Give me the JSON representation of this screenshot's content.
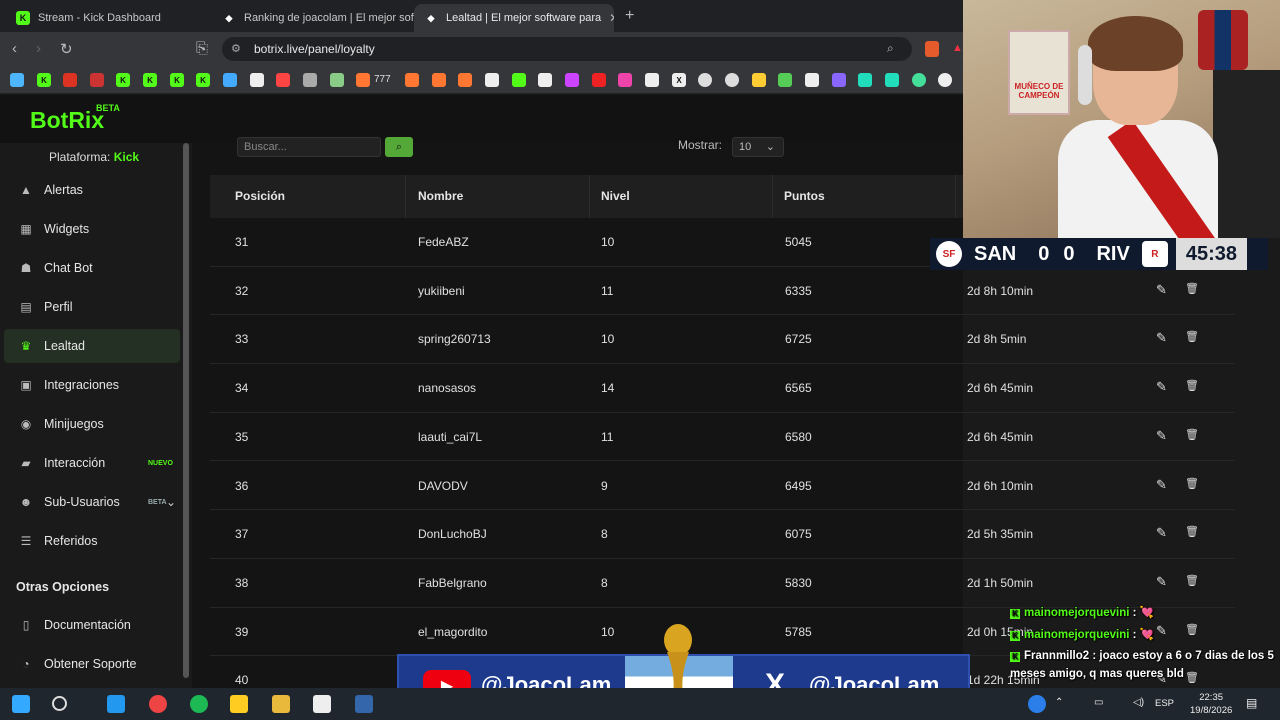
{
  "browser": {
    "tabs": [
      {
        "title": "Stream - Kick Dashboard",
        "fav": "K",
        "fav_color": "#53fc18"
      },
      {
        "title": "Ranking de joacolam | El mejor softw",
        "fav": "◆",
        "fav_color": "#ffffff"
      },
      {
        "title": "Lealtad | El mejor software para",
        "fav": "◆",
        "fav_color": "#ffffff",
        "active": true
      }
    ],
    "close_tab": "✕",
    "new_tab": "+",
    "url": "botrix.live/panel/loyalty",
    "bookmark_badge": "777"
  },
  "app": {
    "logo": "BotRix",
    "logo_badge": "BETA",
    "platform_label": "Plataforma:",
    "platform_value": "Kick"
  },
  "sidebar": {
    "items": [
      {
        "label": "Alertas",
        "icon": "alert-icon",
        "glyph": "▲"
      },
      {
        "label": "Widgets",
        "icon": "widgets-icon",
        "glyph": "▦"
      },
      {
        "label": "Chat Bot",
        "icon": "robot-icon",
        "glyph": "☗"
      },
      {
        "label": "Perfil",
        "icon": "profile-card-icon",
        "glyph": "▤"
      },
      {
        "label": "Lealtad",
        "icon": "trophy-icon",
        "glyph": "♛",
        "active": true
      },
      {
        "label": "Integraciones",
        "icon": "integrations-icon",
        "glyph": "▣"
      },
      {
        "label": "Minijuegos",
        "icon": "gamepad-icon",
        "glyph": "◉"
      },
      {
        "label": "Interacción",
        "icon": "interaction-icon",
        "glyph": "▰",
        "badge": "NUEVO"
      },
      {
        "label": "Sub-Usuarios",
        "icon": "users-icon",
        "glyph": "☻",
        "badge": "BETA",
        "chevron": "⌄"
      },
      {
        "label": "Referidos",
        "icon": "referrals-icon",
        "glyph": "☰"
      }
    ],
    "other_heading": "Otras Opciones",
    "other_items": [
      {
        "label": "Documentación",
        "icon": "document-icon",
        "glyph": "▯"
      },
      {
        "label": "Obtener Soporte",
        "icon": "support-icon",
        "glyph": "◔"
      }
    ]
  },
  "table_controls": {
    "search_placeholder": "Buscar...",
    "show_label": "Mostrar:",
    "show_value": "10"
  },
  "table": {
    "headers": [
      "Posición",
      "Nombre",
      "Nivel",
      "Puntos"
    ],
    "rows": [
      {
        "pos": "31",
        "name": "FedeABZ",
        "level": "10",
        "points": "5045",
        "time": ""
      },
      {
        "pos": "32",
        "name": "yukiibeni",
        "level": "11",
        "points": "6335",
        "time": "2d 8h 10min"
      },
      {
        "pos": "33",
        "name": "spring260713",
        "level": "10",
        "points": "6725",
        "time": "2d 8h 5min"
      },
      {
        "pos": "34",
        "name": "nanosasos",
        "level": "14",
        "points": "6565",
        "time": "2d 6h 45min"
      },
      {
        "pos": "35",
        "name": "laauti_cai7L",
        "level": "11",
        "points": "6580",
        "time": "2d 6h 45min"
      },
      {
        "pos": "36",
        "name": "DAVODV",
        "level": "9",
        "points": "6495",
        "time": "2d 6h 10min"
      },
      {
        "pos": "37",
        "name": "DonLuchoBJ",
        "level": "8",
        "points": "6075",
        "time": "2d 5h 35min"
      },
      {
        "pos": "38",
        "name": "FabBelgrano",
        "level": "8",
        "points": "5830",
        "time": "2d 1h 50min"
      },
      {
        "pos": "39",
        "name": "el_magordito",
        "level": "10",
        "points": "5785",
        "time": "2d 0h 15min"
      },
      {
        "pos": "40",
        "name": "",
        "level": "",
        "points": "",
        "time": "1d 22h 15min"
      }
    ],
    "edit_glyph": "✎",
    "delete_glyph": "🗑"
  },
  "overlay": {
    "poster_text": "MUÑECO DE CAMPEÓN",
    "score": {
      "home": "SAN",
      "home_goals": "0",
      "away_goals": "0",
      "away": "RIV",
      "clock": "45:38"
    },
    "youtube_handle": "@JoacoLam_",
    "x_handle": "@JoacoLam",
    "chat": [
      {
        "user": "mainomejorquevini",
        "text": " : 💘"
      },
      {
        "user": "mainomejorquevini",
        "text": " : 💘"
      },
      {
        "user": "Frannmillo2",
        "text": " : joaco estoy a 6 o 7 dias de los 5"
      },
      {
        "user": "",
        "text": "meses amigo, q mas queres bld"
      }
    ]
  },
  "taskbar": {
    "language": "ESP",
    "time": "22:35",
    "date": "19/8/2026"
  }
}
